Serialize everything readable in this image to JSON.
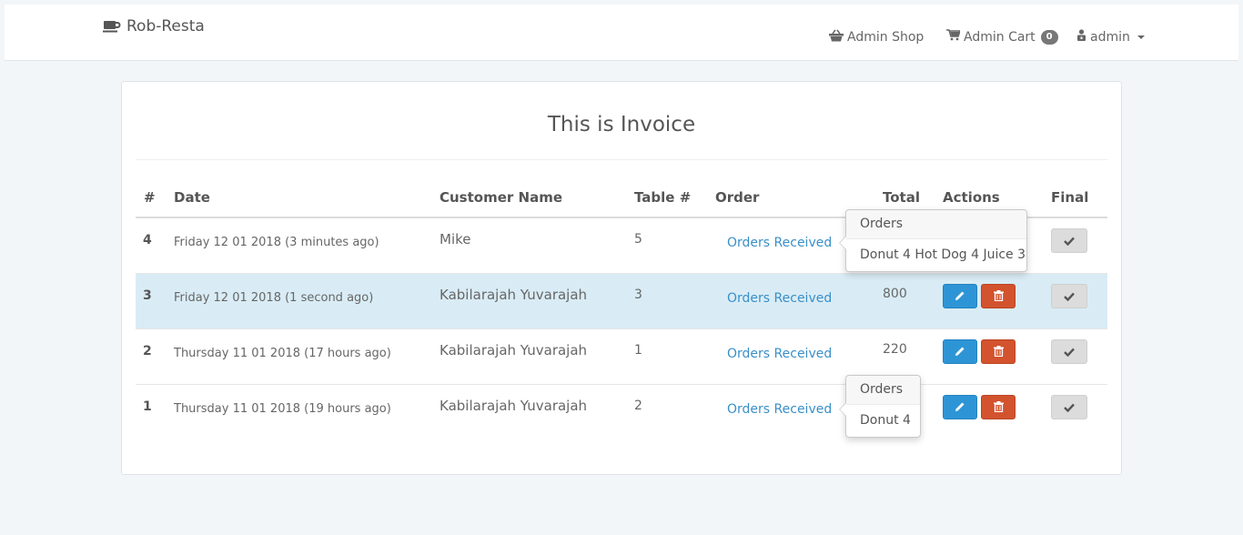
{
  "navbar": {
    "brand": "Rob-Resta",
    "shop_label": "Admin Shop",
    "cart_label": "Admin Cart",
    "cart_count": "0",
    "user_label": "admin"
  },
  "panel": {
    "title": "This is Invoice"
  },
  "table": {
    "headers": {
      "num": "#",
      "date": "Date",
      "customer": "Customer Name",
      "table": "Table #",
      "order": "Order",
      "total": "Total",
      "actions": "Actions",
      "final": "Final"
    },
    "rows": [
      {
        "num": "4",
        "date": "Friday 12 01 2018 (3 minutes ago)",
        "customer": "Mike",
        "table": "5",
        "order": "Orders Received",
        "total": ""
      },
      {
        "num": "3",
        "date": "Friday 12 01 2018 (1 second ago)",
        "customer": "Kabilarajah Yuvarajah",
        "table": "3",
        "order": "Orders Received",
        "total": "800"
      },
      {
        "num": "2",
        "date": "Thursday 11 01 2018 (17 hours ago)",
        "customer": "Kabilarajah Yuvarajah",
        "table": "1",
        "order": "Orders Received",
        "total": "220"
      },
      {
        "num": "1",
        "date": "Thursday 11 01 2018 (19 hours ago)",
        "customer": "Kabilarajah Yuvarajah",
        "table": "2",
        "order": "Orders Received",
        "total": ""
      }
    ]
  },
  "popovers": [
    {
      "title": "Orders",
      "content": "Donut 4 Hot Dog 4 Juice 3"
    },
    {
      "title": "Orders",
      "content": "Donut 4"
    }
  ],
  "icons": {
    "brand": "coffee-cup-icon",
    "shop": "shopping-basket-icon",
    "cart": "shopping-cart-icon",
    "user": "user-lock-icon",
    "edit": "pencil-icon",
    "delete": "trash-icon",
    "final": "checkmark-icon"
  },
  "colors": {
    "background": "#f3f6f9",
    "link": "#3a8fc7",
    "edit_button": "#2d95d6",
    "delete_button": "#d2532e",
    "final_button": "#dcdcdc",
    "active_row": "#d9ecf5"
  }
}
